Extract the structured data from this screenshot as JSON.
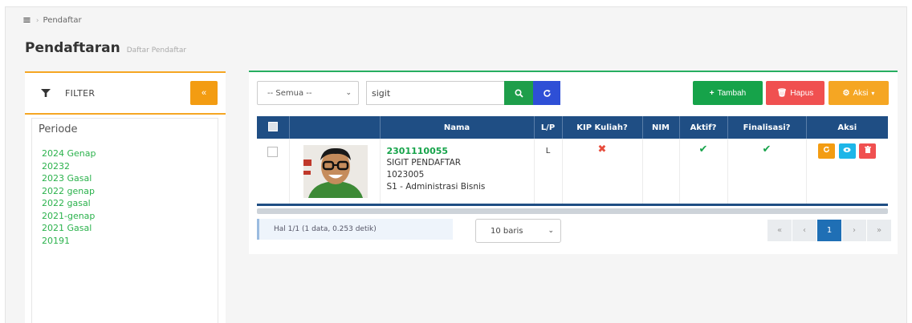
{
  "breadcrumb": {
    "current": "Pendaftar"
  },
  "page": {
    "title": "Pendaftaran",
    "subtitle": "Daftar Pendaftar"
  },
  "filter": {
    "title": "FILTER",
    "collapse_label": "«",
    "periode_label": "Periode",
    "periods": [
      "2024 Genap",
      "20232",
      "2023 Gasal",
      "2022 genap",
      "2022 gasal",
      "2021-genap",
      "2021 Gasal",
      "20191"
    ]
  },
  "toolbar": {
    "select_value": "-- Semua --",
    "search_value": "sigit",
    "tambah_label": "Tambah",
    "hapus_label": "Hapus",
    "aksi_label": "Aksi"
  },
  "table": {
    "headers": [
      "Nama",
      "L/P",
      "KIP Kuliah?",
      "NIM",
      "Aktif?",
      "Finalisasi?",
      "Aksi"
    ],
    "rows": [
      {
        "nomor": "2301110055",
        "nama": "SIGIT PENDAFTAR",
        "kode": "1023005",
        "prodi": "S1 - Administrasi Bisnis",
        "lp": "L",
        "kip": "✖",
        "nim": "",
        "aktif": "✔",
        "finalisasi": "✔"
      }
    ]
  },
  "footer": {
    "info": "Hal 1/1 (1 data, 0.253 detik)",
    "rows_per_page": "10 baris",
    "pager": [
      "«",
      "‹",
      "1",
      "›",
      "»"
    ],
    "current_page": "1"
  },
  "colors": {
    "accent_green": "#16a34a",
    "header_blue": "#1f4e84",
    "orange": "#f39c12",
    "red": "#f05050"
  }
}
